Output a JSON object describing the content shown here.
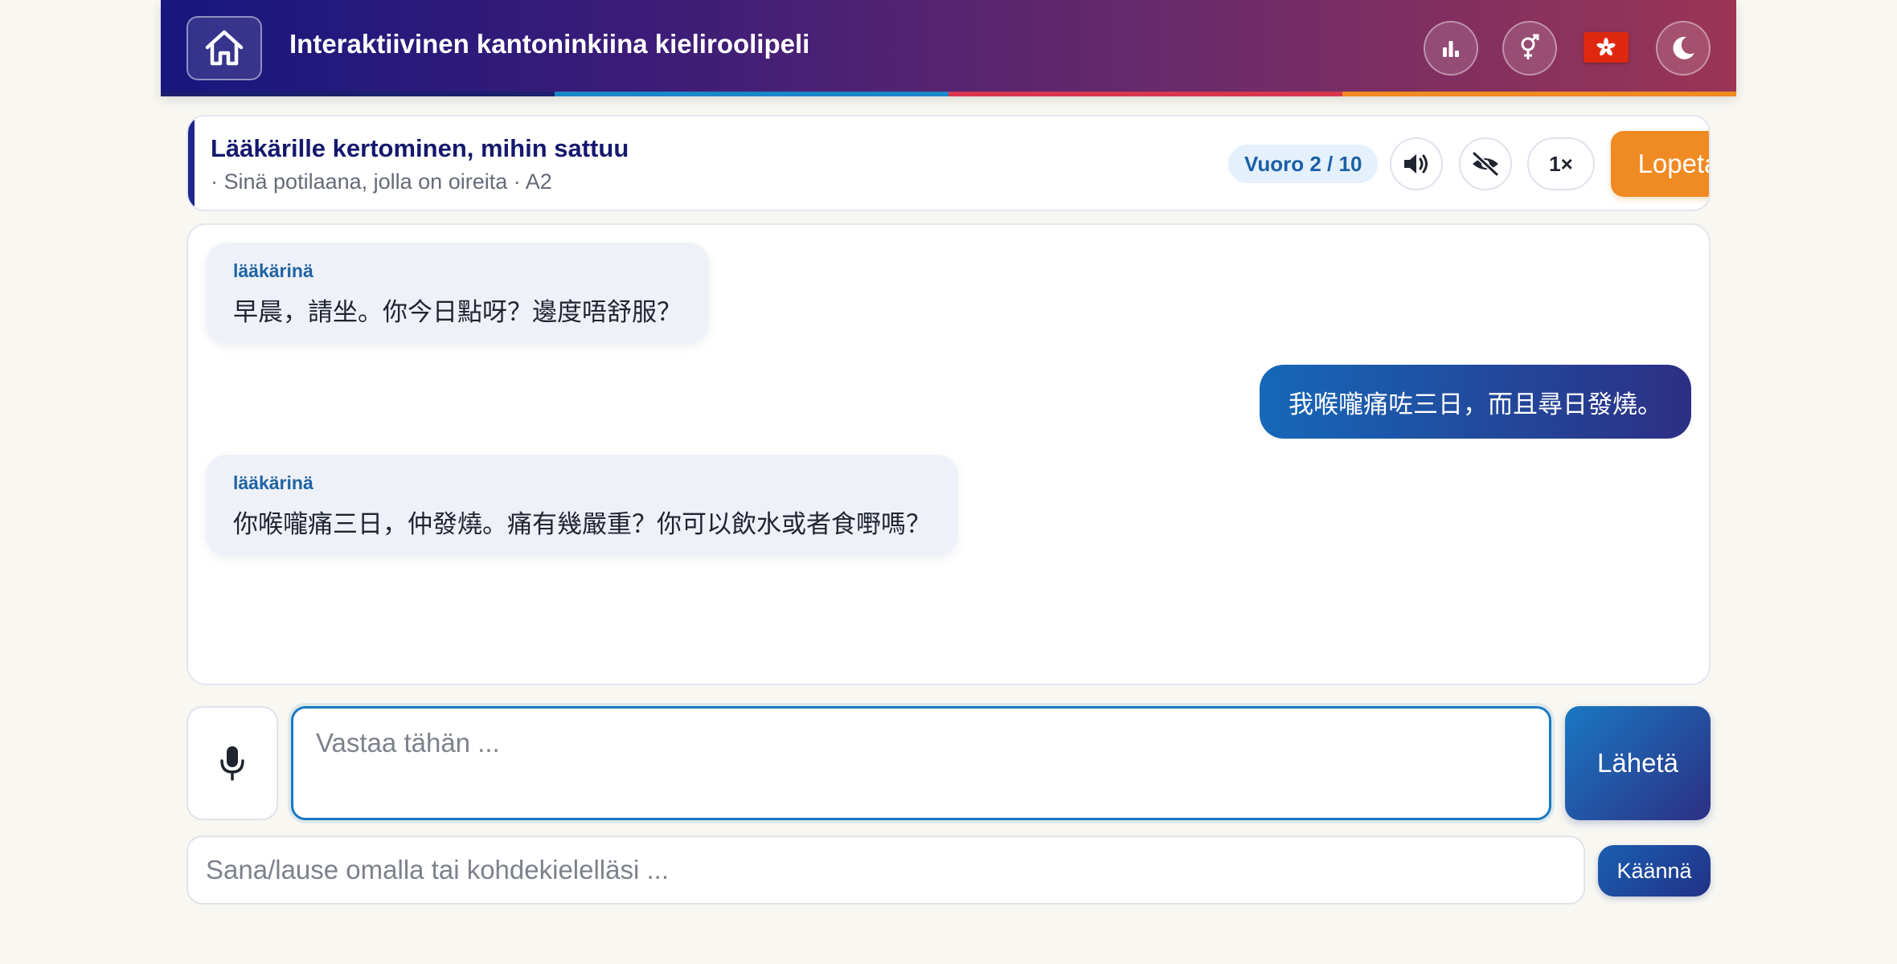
{
  "header": {
    "title": "Interaktiivinen kantoninkiina kieliroolipeli",
    "icons": [
      "home-icon",
      "stats-icon",
      "gender-icon",
      "hong-kong-flag-icon",
      "moon-icon"
    ],
    "stripe_colors": [
      "#1c1f6e",
      "#1b86c8",
      "#d8364f",
      "#f08a22"
    ]
  },
  "scenario": {
    "title": "Lääkärille kertominen, mihin sattuu",
    "subtitle": "· Sinä potilaana, jolla on oireita · A2",
    "turn": "Vuoro 2 / 10",
    "speed": "1×",
    "stop_label": "Lopeta harjoitus"
  },
  "messages": [
    {
      "role": "lääkärinä",
      "text": "早晨，請坐。你今日點呀？邊度唔舒服？"
    },
    {
      "text": "我喉嚨痛咗三日，而且尋日發燒。"
    },
    {
      "role": "lääkärinä",
      "text": "你喉嚨痛三日，仲發燒。痛有幾嚴重？你可以飲水或者食嘢嗎？"
    }
  ],
  "input": {
    "reply_placeholder": "Vastaa tähän ...",
    "send_label": "Lähetä",
    "translate_placeholder": "Sana/lause omalla tai kohdekielelläsi ...",
    "translate_label": "Käännä"
  },
  "colors": {
    "accent_orange": "#f08a22",
    "accent_blue": "#1a78c2",
    "navy": "#1e2590"
  }
}
